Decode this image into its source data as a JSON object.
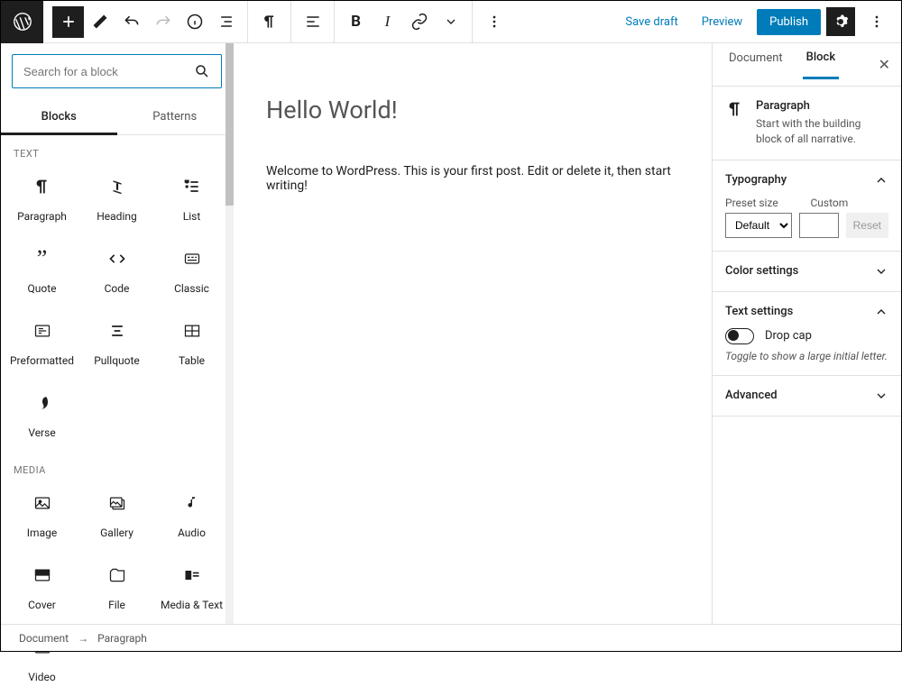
{
  "topbar": {
    "save_draft": "Save draft",
    "preview": "Preview",
    "publish": "Publish"
  },
  "inserter": {
    "search_placeholder": "Search for a block",
    "tabs": {
      "blocks": "Blocks",
      "patterns": "Patterns"
    },
    "cat_text": "TEXT",
    "cat_media": "MEDIA",
    "text_blocks": [
      "Paragraph",
      "Heading",
      "List",
      "Quote",
      "Code",
      "Classic",
      "Preformatted",
      "Pullquote",
      "Table",
      "Verse"
    ],
    "media_blocks": [
      "Image",
      "Gallery",
      "Audio",
      "Cover",
      "File",
      "Media & Text",
      "Video"
    ]
  },
  "canvas": {
    "title": "Hello World!",
    "body": "Welcome to WordPress. This is your first post. Edit or delete it, then start writing!"
  },
  "sidebar": {
    "tab_document": "Document",
    "tab_block": "Block",
    "block_name": "Paragraph",
    "block_desc": "Start with the building block of all narrative.",
    "typography": {
      "title": "Typography",
      "preset_lbl": "Preset size",
      "preset_val": "Default",
      "custom_lbl": "Custom",
      "reset": "Reset"
    },
    "color_title": "Color settings",
    "text_settings": {
      "title": "Text settings",
      "dropcap": "Drop cap",
      "hint": "Toggle to show a large initial letter."
    },
    "advanced_title": "Advanced"
  },
  "breadcrumb": {
    "a": "Document",
    "b": "Paragraph"
  }
}
